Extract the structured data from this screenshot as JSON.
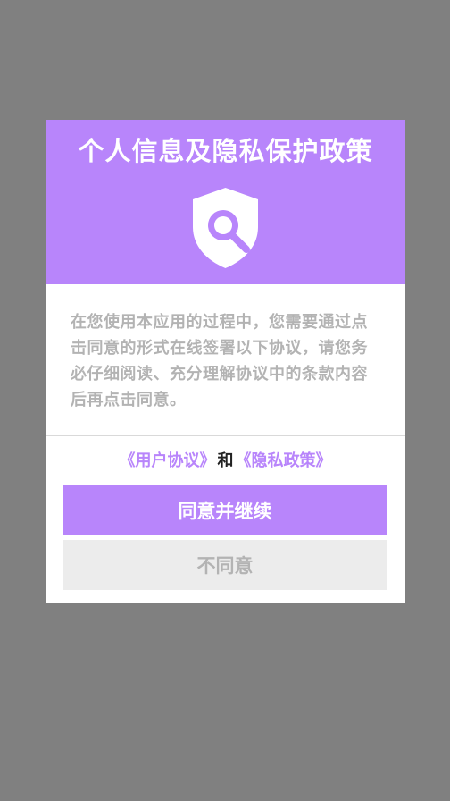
{
  "dialog": {
    "title": "个人信息及隐私保护政策",
    "header_icon": "shield-search-icon",
    "body": "在您使用本应用的过程中，您需要通过点击同意的形式在线签署以下协议，请您务必仔细阅读、充分理解协议中的条款内容后再点击同意。",
    "links": {
      "user_agreement": "《用户协议》",
      "conjunction": "和",
      "privacy_policy": "《隐私政策》"
    },
    "agree_button": "同意并继续",
    "disagree_button": "不同意"
  },
  "colors": {
    "overlay": "#808080",
    "accent": "#b885fb",
    "body_text": "#b3b3b3",
    "secondary_button": "#ececec"
  }
}
